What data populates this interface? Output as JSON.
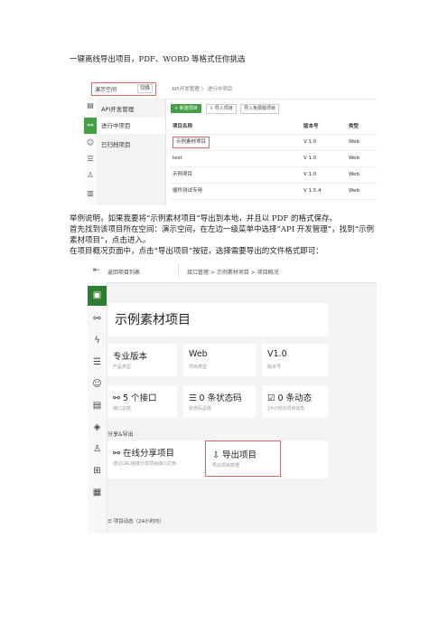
{
  "doc": {
    "heading": "一键离线导出项目，PDF、WORD 等格式任你挑选",
    "para1": "举例说明，如果我要将“示例素材项目”导出到本地，并且以 PDF 的格式保存。",
    "para2": "首先找到该项目所在空间：演示空间，在左边一级菜单中选择“API 开发管理”，找到“示例素材项目”，点击进入。",
    "para3": "在项目概况页面中，点击“导出项目”按钮，选择需要导出的文件格式即可："
  },
  "shot1": {
    "workspace": "演示空间",
    "switch_label": "切换",
    "breadcrumb": "API开发管理  〉  进行中项目",
    "menu": [
      "API开发管理",
      "进行中项目",
      "已归档项目"
    ],
    "buttons": [
      "+ 新建项目",
      "⇪ 导入项目",
      "导入免费版项目"
    ],
    "table": {
      "headers": [
        "项目名称",
        "版本号",
        "类型"
      ],
      "rows": [
        [
          "示例素材项目",
          "V 1.0",
          "Web"
        ],
        [
          "test",
          "V 1.0",
          "Web"
        ],
        [
          "示例项目",
          "V 1.0",
          "Web"
        ],
        [
          "插件测试专用",
          "V 1.5.4",
          "Web"
        ]
      ]
    }
  },
  "shot2": {
    "back_label": "返回项目列表",
    "breadcrumb": "接口管理  >  示例素材项目  >  项目概况",
    "project_title": "示例素材项目",
    "info_cards": [
      {
        "big": "专业版本",
        "small": "产品类型"
      },
      {
        "big": "Web",
        "small": "项目类型"
      },
      {
        "big": "V1.0",
        "small": "版本号"
      }
    ],
    "stat_cards": [
      {
        "big": "⚯ 5 个接口",
        "small": "接口总数"
      },
      {
        "big": "☰ 0 条状态码",
        "small": "状态码总数"
      },
      {
        "big": "☑ 0 条动态",
        "small": "24小时内项目动态"
      }
    ],
    "section_label": "分享&导出",
    "share": {
      "big": "⚯ 在线分享项目",
      "small": "通过URL链接分享项目接口文档"
    },
    "export": {
      "big": "⇩ 导出项目",
      "small": "导出项目数据"
    },
    "footer": "☰ 项目动态（24小时内）"
  }
}
